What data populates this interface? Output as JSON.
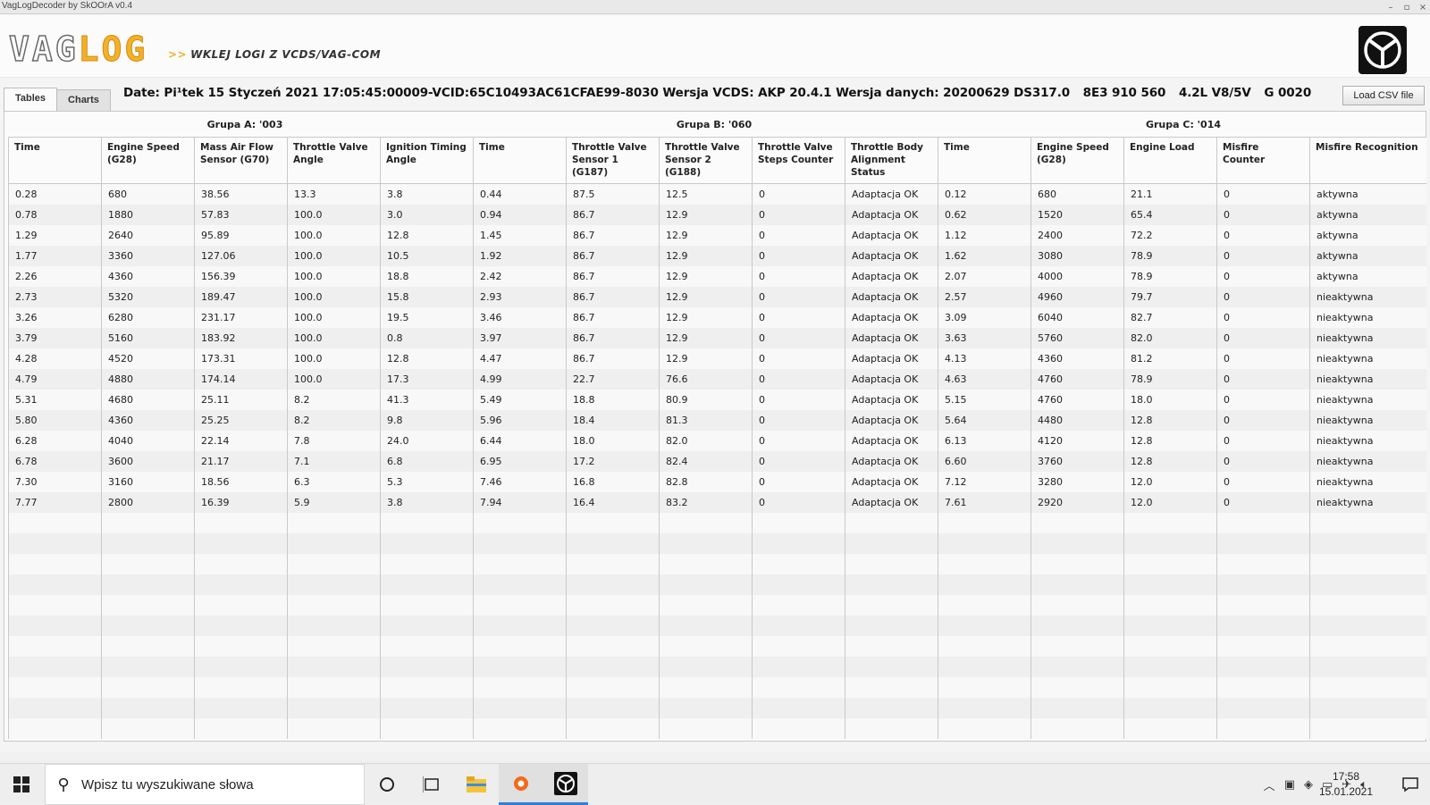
{
  "window": {
    "title": "VagLogDecoder by SkOOrA v0.4",
    "controls": [
      "–",
      "▫",
      "×"
    ]
  },
  "header": {
    "logo_part1": "VAG",
    "logo_part2": "LOG",
    "tagline_arrows": ">>",
    "tagline": "WKLEJ LOGI Z VCDS/VAG-COM",
    "brand_icon": "vw-badge-icon"
  },
  "tabs": [
    {
      "label": "Tables",
      "active": true
    },
    {
      "label": "Charts",
      "active": false
    }
  ],
  "info": {
    "date": "Date: Pi¹tek 15 Styczeń 2021 17:05:45:00009-VCID:65C10493AC61CFAE99-8030 Wersja VCDS: AKP 20.4.1 Wersja danych: 20200629 DS317.0",
    "part": "8E3 910 560",
    "engine": "4.2L V8/5V",
    "code": "G   0020"
  },
  "load_button": "Load CSV file",
  "groups": [
    {
      "label": "Grupa A: '003"
    },
    {
      "label": "Grupa B: '060"
    },
    {
      "label": "Grupa C: '014"
    }
  ],
  "columns": [
    "Time",
    "Engine Speed (G28)",
    "Mass Air Flow Sensor (G70)",
    "Throttle Valve Angle",
    "Ignition Timing Angle",
    "Time",
    "Throttle Valve Sensor 1 (G187)",
    "Throttle Valve Sensor 2 (G188)",
    "Throttle Valve Steps Counter",
    "Throttle Body Alignment Status",
    "Time",
    "Engine Speed (G28)",
    "Engine Load",
    "Misfire Counter",
    "Misfire Recognition"
  ],
  "rows": [
    [
      "0.28",
      "680",
      "38.56",
      "13.3",
      "3.8",
      "0.44",
      "87.5",
      "12.5",
      "0",
      "Adaptacja OK",
      "0.12",
      "680",
      "21.1",
      "0",
      "aktywna"
    ],
    [
      "0.78",
      "1880",
      "57.83",
      "100.0",
      "3.0",
      "0.94",
      "86.7",
      "12.9",
      "0",
      "Adaptacja OK",
      "0.62",
      "1520",
      "65.4",
      "0",
      "aktywna"
    ],
    [
      "1.29",
      "2640",
      "95.89",
      "100.0",
      "12.8",
      "1.45",
      "86.7",
      "12.9",
      "0",
      "Adaptacja OK",
      "1.12",
      "2400",
      "72.2",
      "0",
      "aktywna"
    ],
    [
      "1.77",
      "3360",
      "127.06",
      "100.0",
      "10.5",
      "1.92",
      "86.7",
      "12.9",
      "0",
      "Adaptacja OK",
      "1.62",
      "3080",
      "78.9",
      "0",
      "aktywna"
    ],
    [
      "2.26",
      "4360",
      "156.39",
      "100.0",
      "18.8",
      "2.42",
      "86.7",
      "12.9",
      "0",
      "Adaptacja OK",
      "2.07",
      "4000",
      "78.9",
      "0",
      "aktywna"
    ],
    [
      "2.73",
      "5320",
      "189.47",
      "100.0",
      "15.8",
      "2.93",
      "86.7",
      "12.9",
      "0",
      "Adaptacja OK",
      "2.57",
      "4960",
      "79.7",
      "0",
      "nieaktywna"
    ],
    [
      "3.26",
      "6280",
      "231.17",
      "100.0",
      "19.5",
      "3.46",
      "86.7",
      "12.9",
      "0",
      "Adaptacja OK",
      "3.09",
      "6040",
      "82.7",
      "0",
      "nieaktywna"
    ],
    [
      "3.79",
      "5160",
      "183.92",
      "100.0",
      "0.8",
      "3.97",
      "86.7",
      "12.9",
      "0",
      "Adaptacja OK",
      "3.63",
      "5760",
      "82.0",
      "0",
      "nieaktywna"
    ],
    [
      "4.28",
      "4520",
      "173.31",
      "100.0",
      "12.8",
      "4.47",
      "86.7",
      "12.9",
      "0",
      "Adaptacja OK",
      "4.13",
      "4360",
      "81.2",
      "0",
      "nieaktywna"
    ],
    [
      "4.79",
      "4880",
      "174.14",
      "100.0",
      "17.3",
      "4.99",
      "22.7",
      "76.6",
      "0",
      "Adaptacja OK",
      "4.63",
      "4760",
      "78.9",
      "0",
      "nieaktywna"
    ],
    [
      "5.31",
      "4680",
      "25.11",
      "8.2",
      "41.3",
      "5.49",
      "18.8",
      "80.9",
      "0",
      "Adaptacja OK",
      "5.15",
      "4760",
      "18.0",
      "0",
      "nieaktywna"
    ],
    [
      "5.80",
      "4360",
      "25.25",
      "8.2",
      "9.8",
      "5.96",
      "18.4",
      "81.3",
      "0",
      "Adaptacja OK",
      "5.64",
      "4480",
      "12.8",
      "0",
      "nieaktywna"
    ],
    [
      "6.28",
      "4040",
      "22.14",
      "7.8",
      "24.0",
      "6.44",
      "18.0",
      "82.0",
      "0",
      "Adaptacja OK",
      "6.13",
      "4120",
      "12.8",
      "0",
      "nieaktywna"
    ],
    [
      "6.78",
      "3600",
      "21.17",
      "7.1",
      "6.8",
      "6.95",
      "17.2",
      "82.4",
      "0",
      "Adaptacja OK",
      "6.60",
      "3760",
      "12.8",
      "0",
      "nieaktywna"
    ],
    [
      "7.30",
      "3160",
      "18.56",
      "6.3",
      "5.3",
      "7.46",
      "16.8",
      "82.8",
      "0",
      "Adaptacja OK",
      "7.12",
      "3280",
      "12.0",
      "0",
      "nieaktywna"
    ],
    [
      "7.77",
      "2800",
      "16.39",
      "5.9",
      "3.8",
      "7.94",
      "16.4",
      "83.2",
      "0",
      "Adaptacja OK",
      "7.61",
      "2920",
      "12.0",
      "0",
      "nieaktywna"
    ]
  ],
  "empty_rows": 11,
  "taskbar": {
    "search_placeholder": "Wpisz tu wyszukiwane słowa",
    "time": "17:58",
    "date": "15.01.2021",
    "icons": [
      "windows-start-icon",
      "search-icon",
      "cortana-icon",
      "task-view-icon",
      "file-explorer-icon",
      "origin-icon",
      "vw-app-icon"
    ],
    "tray_icons": [
      "chevron-up-icon",
      "meet-now-icon",
      "wifi-icon",
      "battery-icon",
      "airplane-icon",
      "volume-icon",
      "notification-icon"
    ]
  }
}
